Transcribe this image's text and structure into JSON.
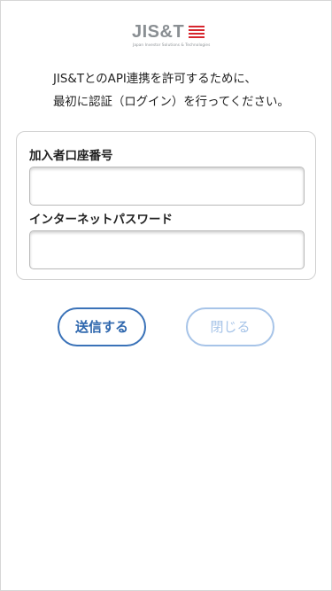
{
  "logo": {
    "name": "JIS&T",
    "tagline": "Japan Investor Solutions & Technologies",
    "accent_color": "#d7262e"
  },
  "intro": {
    "line1": "JIS&TとのAPI連携を許可するために、",
    "line2": "最初に認証（ログイン）を行ってください。"
  },
  "form": {
    "account_number": {
      "label": "加入者口座番号",
      "value": "",
      "placeholder": ""
    },
    "internet_password": {
      "label": "インターネットパスワード",
      "value": "",
      "placeholder": ""
    }
  },
  "buttons": {
    "submit_label": "送信する",
    "close_label": "閉じる",
    "primary_color": "#3a72b8",
    "disabled_color": "#a7c4e8"
  }
}
